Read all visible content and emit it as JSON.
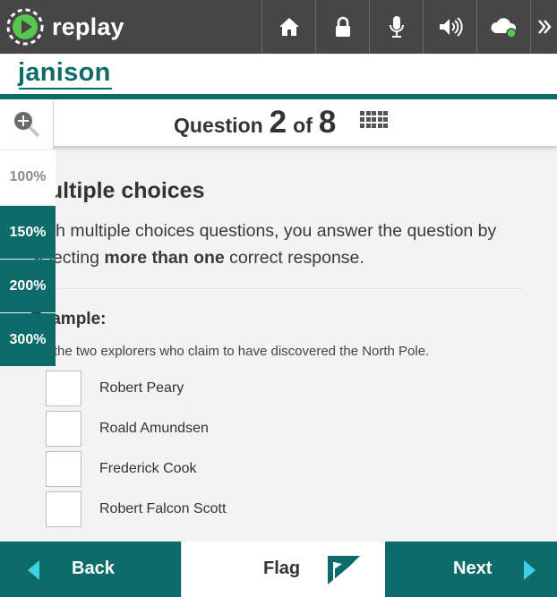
{
  "app": {
    "name": "replay"
  },
  "toolbar": {
    "buttons": [
      {
        "name": "home",
        "icon": "home-icon"
      },
      {
        "name": "lock",
        "icon": "lock-icon"
      },
      {
        "name": "microphone",
        "icon": "microphone-icon"
      },
      {
        "name": "volume",
        "icon": "volume-icon"
      },
      {
        "name": "cloud-status",
        "icon": "cloud-icon",
        "status_color": "#57c84d"
      },
      {
        "name": "expand",
        "icon": "double-chevron-right-icon"
      }
    ]
  },
  "header": {
    "brand": "janison"
  },
  "question": {
    "label": "Question",
    "current": "2",
    "of_label": "of",
    "total": "8",
    "grid_icon": "grid-icon"
  },
  "zoom": {
    "icon": "zoom-in-icon",
    "options": [
      "100%",
      "150%",
      "200%",
      "300%"
    ],
    "selected": "100%"
  },
  "content": {
    "title": "Multiple choices",
    "paragraph": {
      "part1": "With multiple choices questions, you answer the question by selecting ",
      "bold": "more than one",
      "part2": " correct response."
    },
    "example_label": "Example:",
    "prompt": "Select the two explorers who claim to have discovered the North Pole.",
    "options": [
      "Robert Peary",
      "Roald Amundsen",
      "Frederick Cook",
      "Robert Falcon Scott"
    ]
  },
  "nav": {
    "back": "Back",
    "flag": "Flag",
    "next": "Next"
  },
  "colors": {
    "teal": "#0d6b69",
    "topbar": "#464646",
    "content_bg": "#f3f3f3",
    "accent_green": "#57c84d"
  }
}
